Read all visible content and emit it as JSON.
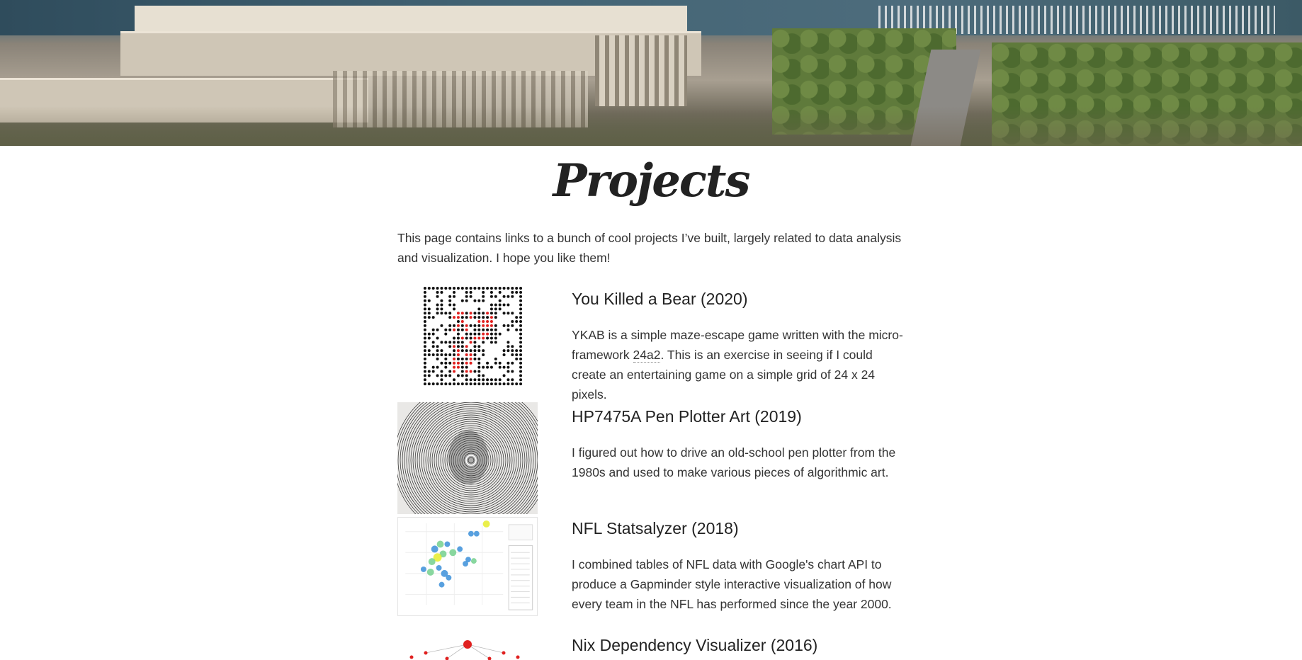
{
  "page": {
    "title": "Projects",
    "intro": "This page contains links to a bunch of cool projects I’ve built, largely related to data analysis and visualization. I hope you like them!"
  },
  "projects": [
    {
      "title": "You Killed a Bear (2020)",
      "desc_before": "YKAB is a simple maze-escape game written with the micro-framework ",
      "link": "24a2",
      "desc_after": ". This is an exercise in seeing if I could create an entertaining game on a simple grid of 24 x 24 pixels.",
      "thumb_icon": "maze-grid-thumbnail"
    },
    {
      "title": "HP7475A Pen Plotter Art (2019)",
      "desc": "I figured out how to drive an old-school pen plotter from the 1980s and used to make various pieces of algorithmic art.",
      "thumb_icon": "pen-plotter-portrait-thumbnail"
    },
    {
      "title": "NFL Statsalyzer (2018)",
      "desc": "I combined tables of NFL data with Google's chart API to produce a Gapminder style interactive visualization of how every team in the NFL has performed since the year 2000.",
      "thumb_icon": "bubble-chart-thumbnail"
    },
    {
      "title": "Nix Dependency Visualizer (2016)",
      "thumb_icon": "dependency-graph-thumbnail"
    }
  ],
  "colors": {
    "accent_red": "#e0201f",
    "bubble_blue": "#3b8fd9",
    "bubble_green": "#74d08e",
    "bubble_yellow": "#e6ec2b",
    "text": "#333333"
  }
}
